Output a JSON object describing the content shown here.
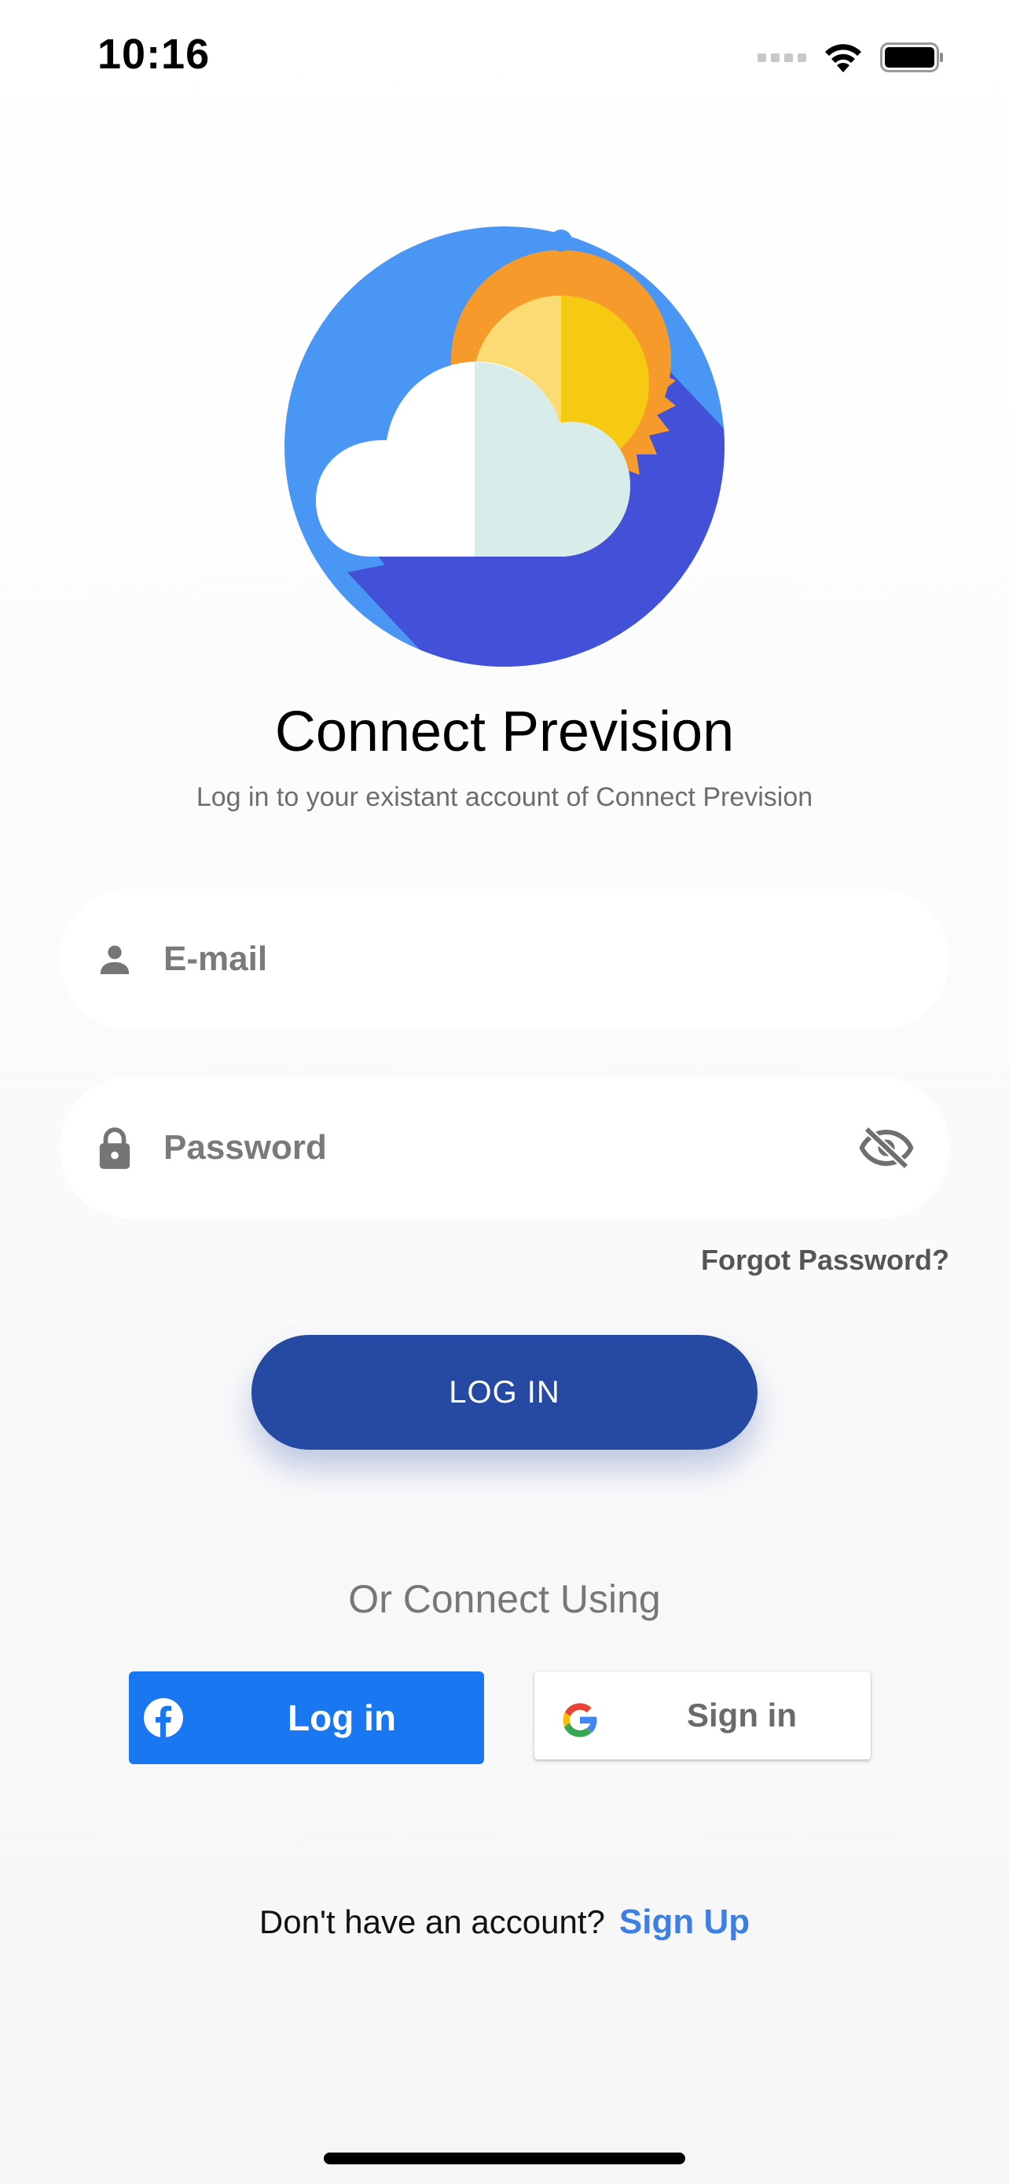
{
  "status_bar": {
    "time": "10:16"
  },
  "app": {
    "title": "Connect Prevision",
    "subtitle": "Log in to your existant account of Connect Prevision"
  },
  "form": {
    "email_placeholder": "E-mail",
    "password_placeholder": "Password",
    "forgot_password": "Forgot Password?",
    "login_button": "LOG IN"
  },
  "social": {
    "heading": "Or Connect Using",
    "facebook_label": "Log in",
    "google_label": "Sign in"
  },
  "signup": {
    "prompt": "Don't have an account?",
    "link": "Sign Up"
  },
  "colors": {
    "primary_button": "#264aa3",
    "facebook_blue": "#1977f2",
    "link_blue": "#3d7fe3",
    "logo_sky": "#4a96f5",
    "logo_shadow": "#4351d9",
    "sun_orange": "#f79a2c",
    "sun_yellow": "#f6c913"
  },
  "icons": {
    "email_field": "person-icon",
    "password_field": "lock-icon",
    "password_toggle": "eye-slash-icon",
    "facebook": "facebook-icon",
    "google": "google-icon"
  }
}
